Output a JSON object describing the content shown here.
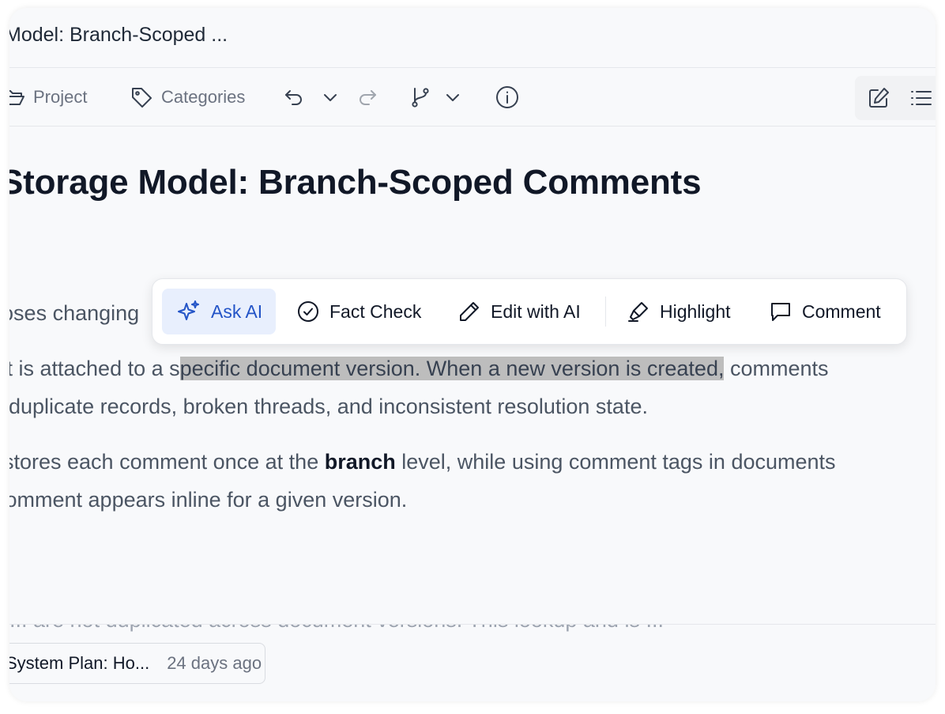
{
  "title": "Model: Branch-Scoped ...",
  "toolbar": {
    "project_label": "Project",
    "categories_label": "Categories"
  },
  "heading": "Storage Model: Branch-Scoped Comments",
  "para1": "proposes changing",
  "para2": {
    "pre": "It is attached to a s",
    "selected": "pecific document version. When a new version is created,",
    "post": " comments"
  },
  "para3": "duplicate records, broken threads, and inconsistent resolution state.",
  "para4": {
    "pre": "stores each comment once at the ",
    "bold": "branch",
    "post": " level, while using comment tags in documents"
  },
  "para5": "comment appears inline for a given version.",
  "faded_line": "... are not duplicated across document versions. This lookup and is ...",
  "popup": {
    "ask_ai": "Ask AI",
    "fact_check": "Fact Check",
    "edit_ai": "Edit with AI",
    "highlight": "Highlight",
    "comment": "Comment"
  },
  "version": {
    "name": "System Plan: Ho...",
    "age": "24 days ago"
  },
  "colors": {
    "accent": "#2354c7",
    "accent_bg": "#e8effd",
    "selection": "#bdbdbd"
  }
}
